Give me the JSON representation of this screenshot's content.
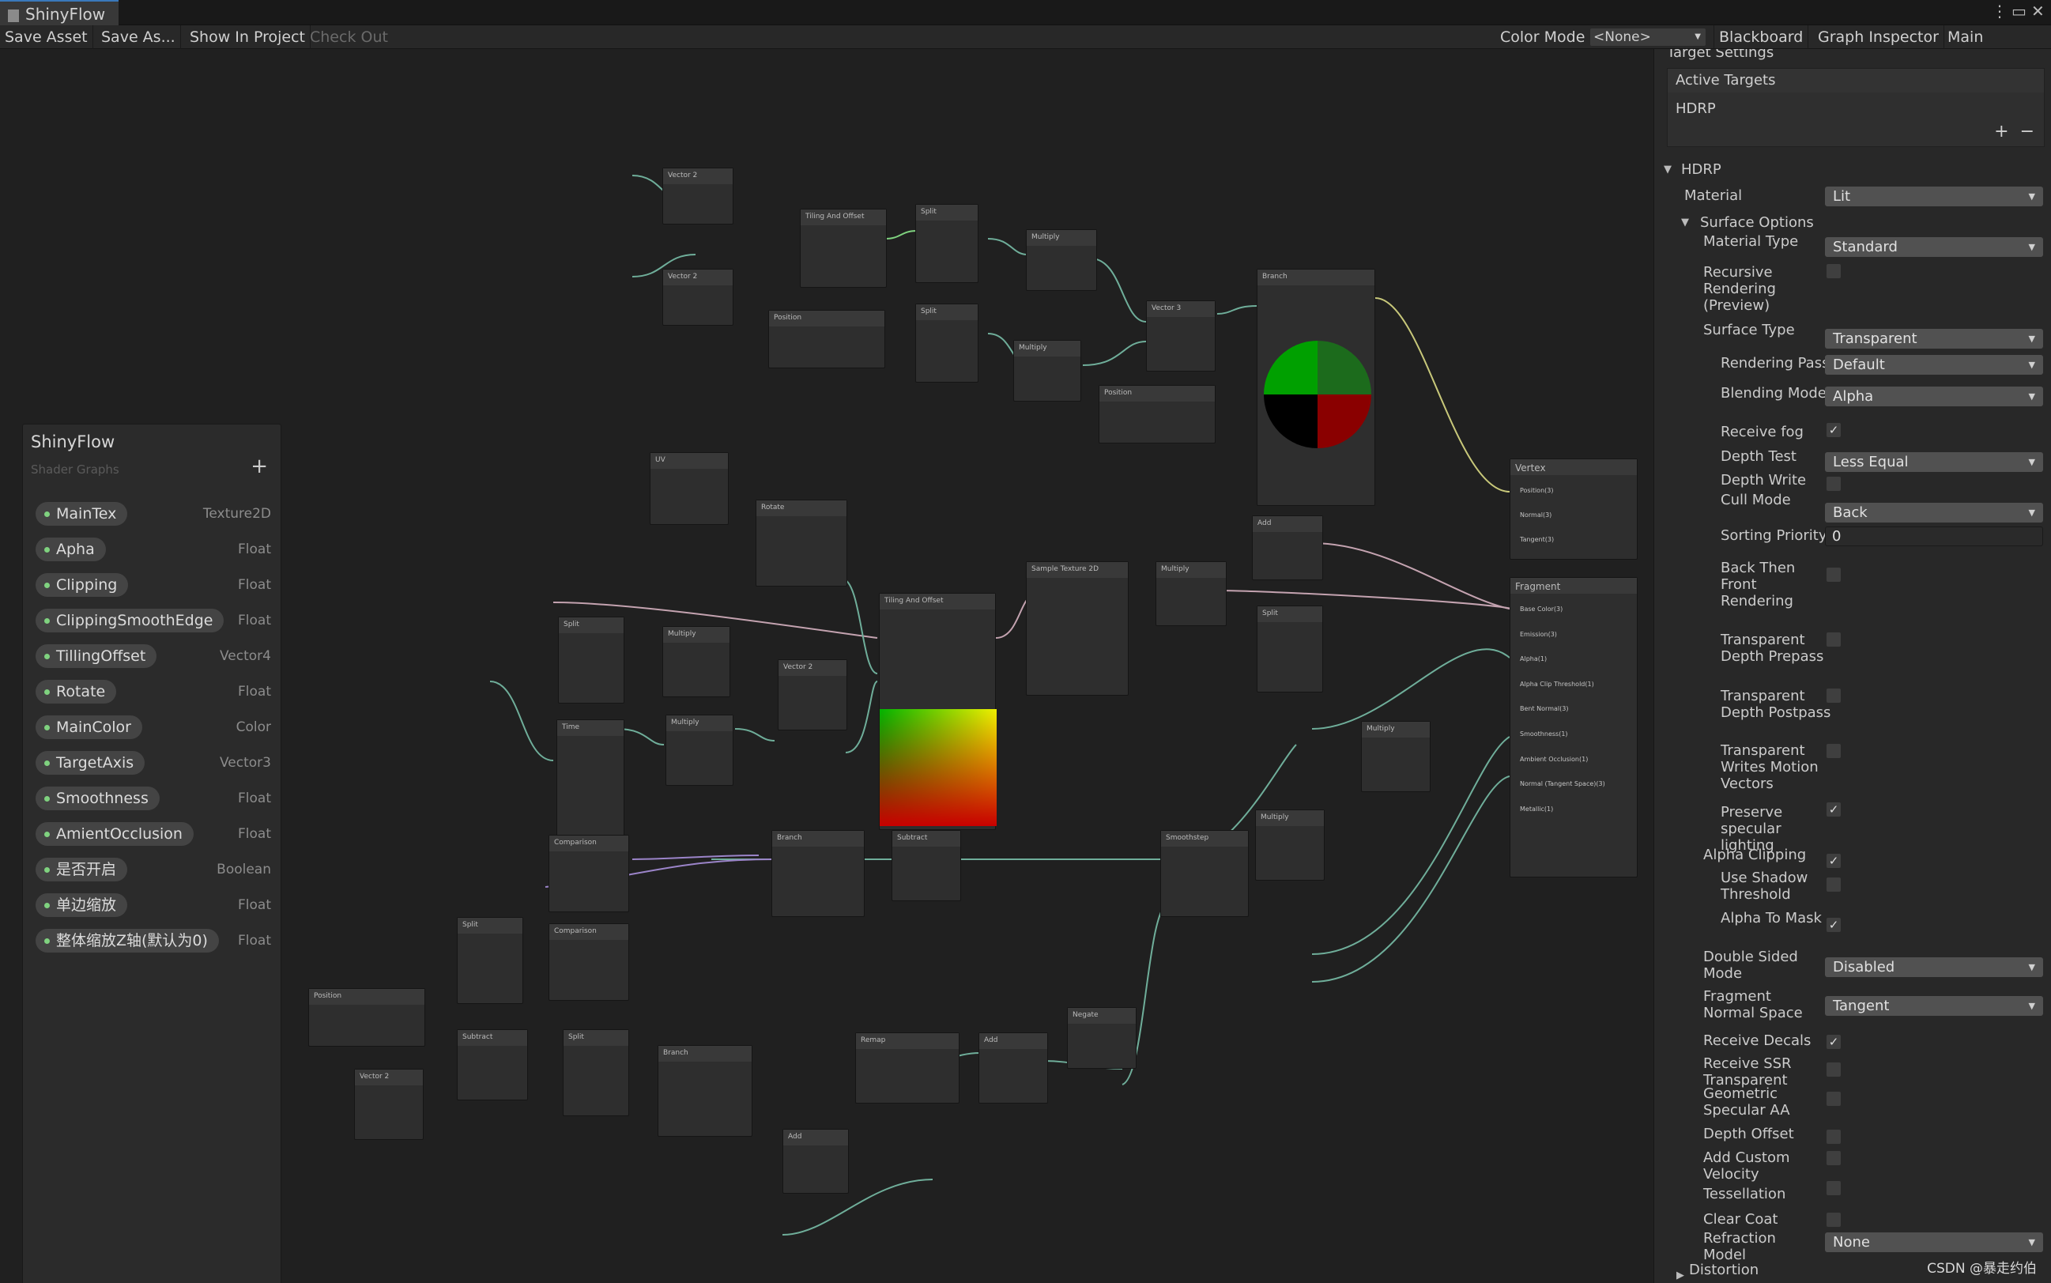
{
  "window": {
    "tab_title": "ShinyFlow"
  },
  "toolbar": {
    "save_asset": "Save Asset",
    "save_as": "Save As...",
    "show_in_project": "Show In Project",
    "check_out": "Check Out",
    "color_mode_label": "Color Mode",
    "color_mode_value": "<None>",
    "blackboard": "Blackboard",
    "graph_inspector": "Graph Inspector",
    "main_preview": "Main Preview"
  },
  "blackboard": {
    "title": "ShinyFlow",
    "subtitle": "Shader Graphs",
    "add": "+",
    "properties": [
      {
        "name": "MainTex",
        "type": "Texture2D"
      },
      {
        "name": "Apha",
        "type": "Float"
      },
      {
        "name": "Clipping",
        "type": "Float"
      },
      {
        "name": "ClippingSmoothEdge",
        "type": "Float"
      },
      {
        "name": "TillingOffset",
        "type": "Vector4"
      },
      {
        "name": "Rotate",
        "type": "Float"
      },
      {
        "name": "MainColor",
        "type": "Color"
      },
      {
        "name": "TargetAxis",
        "type": "Vector3"
      },
      {
        "name": "Smoothness",
        "type": "Float"
      },
      {
        "name": "AmientOcclusion",
        "type": "Float"
      },
      {
        "name": "是否开启",
        "type": "Boolean"
      },
      {
        "name": "单边缩放",
        "type": "Float"
      },
      {
        "name": "整体缩放Z轴(默认为0)",
        "type": "Float"
      }
    ]
  },
  "graph": {
    "nodes": [
      {
        "title": "Vector 2"
      },
      {
        "title": "Vector 2"
      },
      {
        "title": "Tiling And Offset"
      },
      {
        "title": "Split"
      },
      {
        "title": "Split"
      },
      {
        "title": "Multiply"
      },
      {
        "title": "Multiply"
      },
      {
        "title": "Vector 3"
      },
      {
        "title": "Branch"
      },
      {
        "title": "Position"
      },
      {
        "title": "Position"
      },
      {
        "title": "UV"
      },
      {
        "title": "Rotate"
      },
      {
        "title": "Tiling And Offset"
      },
      {
        "title": "Sample Texture 2D"
      },
      {
        "title": "Multiply"
      },
      {
        "title": "Add"
      },
      {
        "title": "Split"
      },
      {
        "title": "Split"
      },
      {
        "title": "Multiply"
      },
      {
        "title": "Vector 2"
      },
      {
        "title": "Time"
      },
      {
        "title": "Multiply"
      },
      {
        "title": "Multiply"
      },
      {
        "title": "Multiply"
      },
      {
        "title": "Comparison"
      },
      {
        "title": "Comparison"
      },
      {
        "title": "Branch"
      },
      {
        "title": "Subtract"
      },
      {
        "title": "Smoothstep"
      },
      {
        "title": "Split"
      },
      {
        "title": "Position"
      },
      {
        "title": "Vector 2"
      },
      {
        "title": "Subtract"
      },
      {
        "title": "Split"
      },
      {
        "title": "Branch"
      },
      {
        "title": "Remap"
      },
      {
        "title": "Add"
      },
      {
        "title": "Negate"
      },
      {
        "title": "Add"
      }
    ],
    "master_vertex": {
      "title": "Vertex",
      "slots": [
        "Position(3)",
        "Normal(3)",
        "Tangent(3)"
      ]
    },
    "master_fragment": {
      "title": "Fragment",
      "slots": [
        "Base Color(3)",
        "Emission(3)",
        "Alpha(1)",
        "Alpha Clip Threshold(1)",
        "Bent Normal(3)",
        "Smoothness(1)",
        "Ambient Occlusion(1)",
        "Normal (Tangent Space)(3)",
        "Metallic(1)"
      ]
    }
  },
  "inspector": {
    "header": "Target Settings",
    "active_targets": "Active Targets",
    "target": "HDRP",
    "add": "+",
    "remove": "−",
    "hdrp_section": "HDRP",
    "surface_options": "Surface Options",
    "rows": [
      {
        "label": "Material",
        "kind": "dropdown",
        "value": "Lit"
      },
      {
        "label": "Material Type",
        "kind": "dropdown",
        "value": "Standard"
      },
      {
        "label": "Recursive Rendering (Preview)",
        "kind": "check",
        "value": ""
      },
      {
        "label": "Surface Type",
        "kind": "dropdown",
        "value": "Transparent"
      },
      {
        "label": "Rendering Pass",
        "kind": "dropdown",
        "value": "Default"
      },
      {
        "label": "Blending Mode",
        "kind": "dropdown",
        "value": "Alpha"
      },
      {
        "label": "Receive fog",
        "kind": "check",
        "value": "✓"
      },
      {
        "label": "Depth Test",
        "kind": "dropdown",
        "value": "Less Equal"
      },
      {
        "label": "Depth Write",
        "kind": "check",
        "value": ""
      },
      {
        "label": "Cull Mode",
        "kind": "dropdown",
        "value": "Back"
      },
      {
        "label": "Sorting Priority",
        "kind": "number",
        "value": "0"
      },
      {
        "label": "Back Then Front Rendering",
        "kind": "check",
        "value": ""
      },
      {
        "label": "Transparent Depth Prepass",
        "kind": "check",
        "value": ""
      },
      {
        "label": "Transparent Depth Postpass",
        "kind": "check",
        "value": ""
      },
      {
        "label": "Transparent Writes Motion Vectors",
        "kind": "check",
        "value": ""
      },
      {
        "label": "Preserve specular lighting",
        "kind": "check",
        "value": "✓"
      },
      {
        "label": "Alpha Clipping",
        "kind": "check",
        "value": "✓"
      },
      {
        "label": "Use Shadow Threshold",
        "kind": "check",
        "value": ""
      },
      {
        "label": "Alpha To Mask",
        "kind": "check",
        "value": "✓"
      },
      {
        "label": "Double Sided Mode",
        "kind": "dropdown",
        "value": "Disabled"
      },
      {
        "label": "Fragment Normal Space",
        "kind": "dropdown",
        "value": "Tangent"
      },
      {
        "label": "Receive Decals",
        "kind": "check",
        "value": "✓"
      },
      {
        "label": "Receive SSR Transparent",
        "kind": "check",
        "value": ""
      },
      {
        "label": "Geometric Specular AA",
        "kind": "check",
        "value": ""
      },
      {
        "label": "Depth Offset",
        "kind": "check",
        "value": ""
      },
      {
        "label": "Add Custom Velocity",
        "kind": "check",
        "value": ""
      },
      {
        "label": "Tessellation",
        "kind": "check",
        "value": ""
      },
      {
        "label": "Clear Coat",
        "kind": "check",
        "value": ""
      },
      {
        "label": "Refraction Model",
        "kind": "dropdown",
        "value": "None"
      },
      {
        "label": "Distortion",
        "kind": "fold",
        "value": ""
      }
    ]
  },
  "watermark": "CSDN @暴走约伯"
}
